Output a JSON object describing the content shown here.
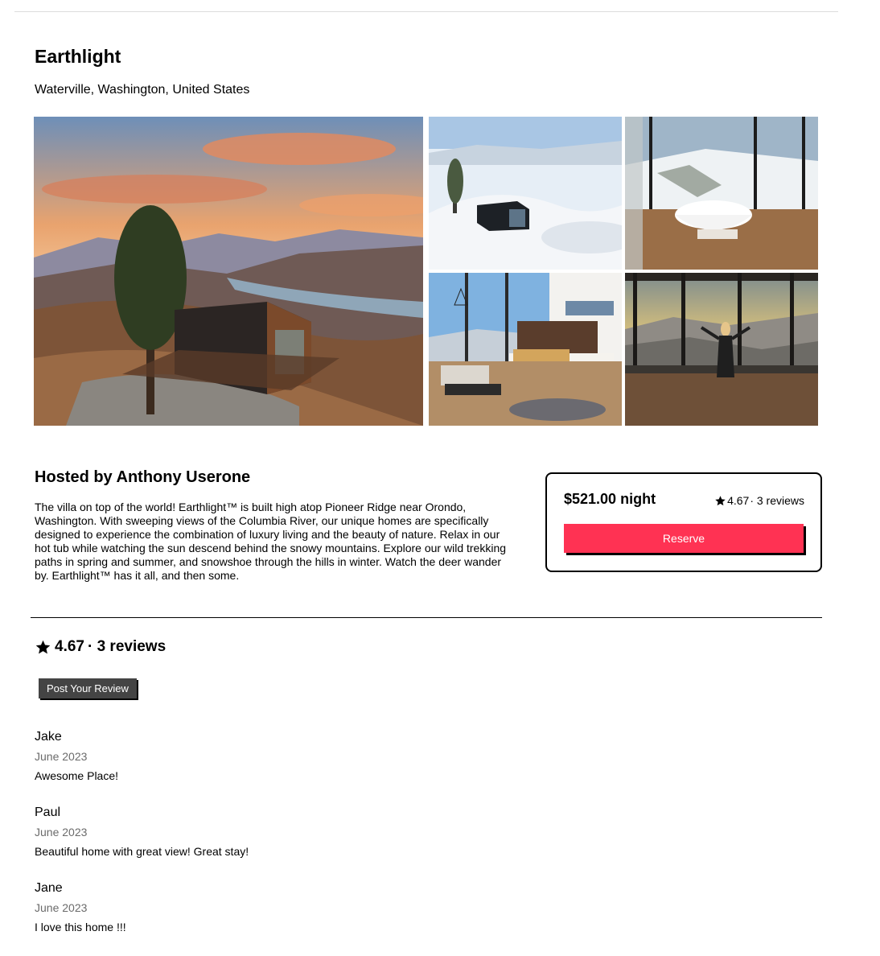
{
  "spot": {
    "name": "Earthlight",
    "location": "Waterville, Washington, United States",
    "host_heading": "Hosted by Anthony Userone",
    "description": "The villa on top of the world! Earthlight™ is built high atop Pioneer Ridge near Orondo, Washington. With sweeping views of the Columbia River, our unique homes are specifically designed to experience the combination of luxury living and the beauty of nature. Relax in our hot tub while watching the sun descend behind the snowy mountains. Explore our wild trekking paths in spring and summer, and snowshoe through the hills in winter. Watch the deer wander by. Earthlight™ has it all, and then some."
  },
  "booking": {
    "price": "$521.00",
    "price_unit": "night",
    "rating": "4.67",
    "reviews_text": "· 3 reviews",
    "reserve_label": "Reserve"
  },
  "reviews_section": {
    "rating": "4.67",
    "reviews_text": "· 3 reviews",
    "post_review_label": "Post Your Review",
    "items": [
      {
        "name": "Jake",
        "date": "June 2023",
        "text": "Awesome Place!"
      },
      {
        "name": "Paul",
        "date": "June 2023",
        "text": "Beautiful home with great view! Great stay!"
      },
      {
        "name": "Jane",
        "date": "June 2023",
        "text": "I love this home !!!"
      }
    ]
  },
  "colors": {
    "reserve_button": "#ff3253",
    "post_review_button": "#444444",
    "review_date": "#6b6b6b"
  },
  "icons": {
    "rating": "star-icon"
  }
}
